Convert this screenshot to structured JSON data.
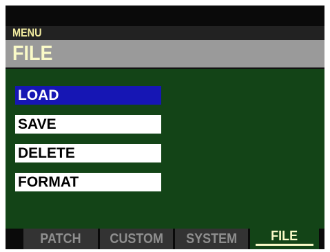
{
  "header": {
    "menu_label": "MENU",
    "title": "FILE"
  },
  "menu": {
    "items": [
      {
        "label": "LOAD",
        "selected": true
      },
      {
        "label": "SAVE",
        "selected": false
      },
      {
        "label": "DELETE",
        "selected": false
      },
      {
        "label": "FORMAT",
        "selected": false
      }
    ]
  },
  "tabs": [
    {
      "label": "PATCH",
      "active": false
    },
    {
      "label": "CUSTOM",
      "active": false
    },
    {
      "label": "SYSTEM",
      "active": false
    },
    {
      "label": "FILE",
      "active": true
    }
  ],
  "colors": {
    "background": "#134417",
    "selection": "#1616b4",
    "title_bar": "#9a9a9a",
    "accent_text": "#fafac8"
  }
}
